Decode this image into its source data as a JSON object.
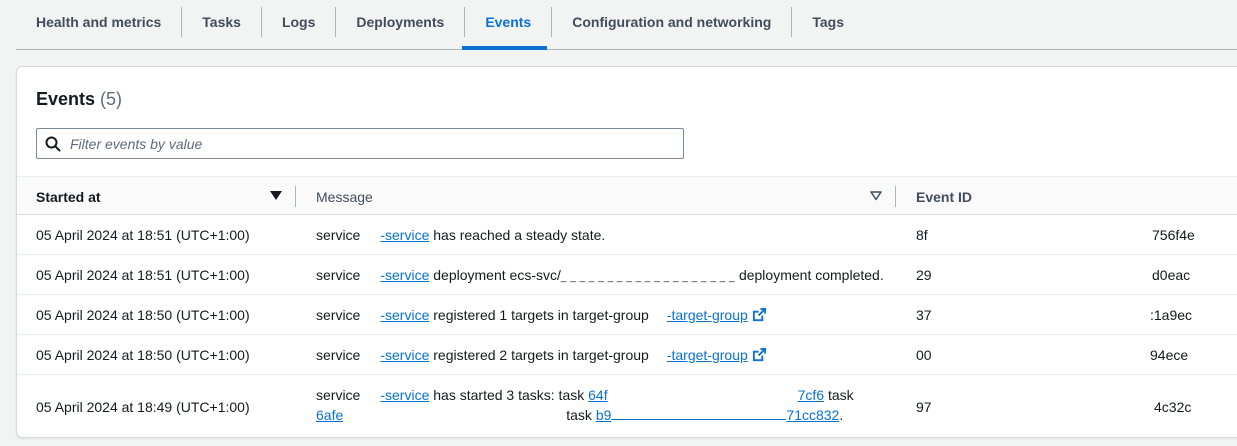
{
  "tabs": [
    {
      "label": "Health and metrics",
      "active": false
    },
    {
      "label": "Tasks",
      "active": false
    },
    {
      "label": "Logs",
      "active": false
    },
    {
      "label": "Deployments",
      "active": false
    },
    {
      "label": "Events",
      "active": true
    },
    {
      "label": "Configuration and networking",
      "active": false
    },
    {
      "label": "Tags",
      "active": false
    }
  ],
  "events": {
    "title": "Events",
    "count": "(5)",
    "filter_placeholder": "Filter events by value",
    "columns": {
      "started_at": "Started at",
      "message": "Message",
      "event_id": "Event ID"
    },
    "rows": [
      {
        "started_at": "05 April 2024 at 18:51 (UTC+1:00)",
        "msg_prefix": "service",
        "service_link": "-service",
        "msg_text": "has reached a steady state.",
        "event_id_start": "8f",
        "event_id_end": "756f4e"
      },
      {
        "started_at": "05 April 2024 at 18:51 (UTC+1:00)",
        "msg_prefix": "service",
        "service_link": "-service",
        "msg_text": "deployment ecs-svc/",
        "msg_redacted": "_ _ _ _ _ _ _ _ _ _ _ _  _ _ _ _ _ _ _",
        "msg_text_end": "deployment completed.",
        "event_id_start": "29",
        "event_id_end": "d0eac"
      },
      {
        "started_at": "05 April 2024 at 18:50 (UTC+1:00)",
        "msg_prefix": "service",
        "service_link": "-service",
        "msg_text": "registered 1 targets in target-group",
        "target_link": "-target-group",
        "event_id_start": "37",
        "event_id_end": ":1a9ec"
      },
      {
        "started_at": "05 April 2024 at 18:50 (UTC+1:00)",
        "msg_prefix": "service",
        "service_link": "-service",
        "msg_text": "registered 2 targets in target-group",
        "target_link": "-target-group",
        "event_id_start": "00",
        "event_id_end": "94ece"
      },
      {
        "started_at": "05 April 2024 at 18:49 (UTC+1:00)",
        "msg_prefix": "service",
        "service_link": "-service",
        "msg_text": "has started 3 tasks: task",
        "task1_link_start": "64f",
        "task1_link_end": "7cf6",
        "task_word": "task",
        "task2_link_start": "6afe",
        "task_word_2": "task",
        "task3_link_start": "b9",
        "task3_link_end": "71cc832",
        "period": ".",
        "event_id_start": "97",
        "event_id_end": "4c32c"
      }
    ]
  }
}
